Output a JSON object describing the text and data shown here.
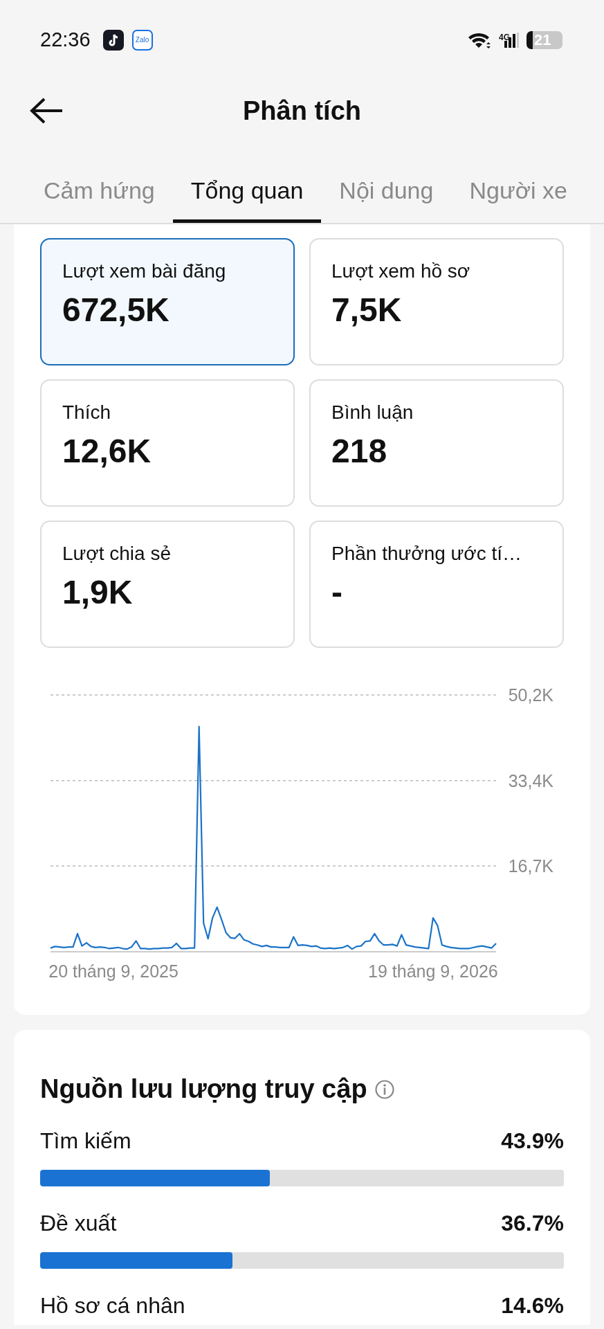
{
  "status_bar": {
    "time": "22:36",
    "apps": [
      {
        "kind": "tiktok"
      },
      {
        "kind": "zalo",
        "label": "Zalo"
      }
    ],
    "network": "4G",
    "battery": "21"
  },
  "header": {
    "title": "Phân tích"
  },
  "tabs": [
    {
      "label": "Cảm hứng",
      "selected": false
    },
    {
      "label": "Tổng quan",
      "selected": true
    },
    {
      "label": "Nội dung",
      "selected": false
    },
    {
      "label": "Người xe",
      "selected": false
    }
  ],
  "stats": [
    {
      "label": "Lượt xem bài đăng",
      "value": "672,5K",
      "selected": true
    },
    {
      "label": "Lượt xem hồ sơ",
      "value": "7,5K",
      "selected": false
    },
    {
      "label": "Thích",
      "value": "12,6K",
      "selected": false
    },
    {
      "label": "Bình luận",
      "value": "218",
      "selected": false
    },
    {
      "label": "Lượt chia sẻ",
      "value": "1,9K",
      "selected": false
    },
    {
      "label": "Phần thưởng ước tí…",
      "value": "-",
      "selected": false
    }
  ],
  "graph": {
    "chart_data": {
      "type": "line",
      "categories": [
        null,
        null,
        null,
        null,
        null,
        null,
        null,
        null,
        null,
        null,
        null,
        null,
        null,
        null,
        "20 tháng 9, 2025",
        null,
        null,
        null,
        null,
        null,
        null,
        null,
        null,
        null,
        null,
        null,
        null,
        null,
        null,
        null,
        null,
        null,
        null,
        null,
        null,
        null,
        null,
        null,
        null,
        null,
        null,
        null,
        null,
        null,
        null,
        null,
        null,
        null,
        null,
        null,
        null,
        null,
        null,
        null,
        null,
        null,
        null,
        null,
        null,
        null,
        null,
        null,
        null,
        null,
        null,
        null,
        null,
        null,
        null,
        null,
        null,
        null,
        null,
        null,
        null,
        null,
        null,
        null,
        null,
        null,
        null,
        null,
        null,
        null,
        null,
        "19 tháng 9, 2026",
        null,
        null,
        null,
        null,
        null,
        null,
        null,
        null,
        null,
        null,
        null,
        null,
        null,
        null
      ],
      "series": [
        {
          "color": "#1b73c7",
          "values": [
            0.6,
            0.9,
            0.8,
            0.7,
            0.8,
            0.8,
            3.4,
            1.0,
            1.6,
            0.9,
            0.7,
            0.8,
            0.7,
            0.5,
            0.6,
            0.7,
            0.5,
            0.4,
            0.8,
            2.0,
            0.5,
            0.5,
            0.4,
            0.5,
            0.5,
            0.6,
            0.6,
            0.7,
            1.5,
            0.5,
            0.5,
            0.6,
            0.6,
            44,
            5.5,
            2.4,
            6.5,
            8.6,
            6.2,
            3.6,
            2.6,
            2.5,
            3.4,
            2.2,
            1.9,
            1.4,
            1.2,
            0.9,
            1.1,
            0.8,
            0.8,
            0.7,
            0.7,
            0.7,
            2.8,
            1.1,
            1.2,
            1.1,
            0.9,
            1.0,
            0.6,
            0.5,
            0.6,
            0.5,
            0.6,
            0.7,
            1.1,
            0.4,
            0.9,
            1.0,
            1.9,
            2.0,
            3.4,
            2.0,
            1.2,
            1.2,
            1.3,
            1.0,
            3.2,
            1.2,
            1.0,
            0.8,
            0.7,
            0.6,
            0.5,
            6.5,
            5.0,
            1.2,
            0.9,
            0.7,
            0.6,
            0.5,
            0.5,
            0.5,
            0.7,
            0.9,
            1.0,
            0.8,
            0.6,
            1.5
          ]
        }
      ],
      "ylim": [
        0,
        50.2
      ],
      "yticks": [
        {
          "value": 50.2,
          "label": "50,2K"
        },
        {
          "value": 33.4,
          "label": "33,4K"
        },
        {
          "value": 16.7,
          "label": "16,7K"
        }
      ]
    }
  },
  "traffic": {
    "title": "Nguồn lưu lượng truy cập",
    "sources": [
      {
        "label": "Tìm kiếm",
        "percent": "43.9%",
        "level": 0.439
      },
      {
        "label": "Đề xuất",
        "percent": "36.7%",
        "level": 0.367
      },
      {
        "label": "Hồ sơ cá nhân",
        "percent": "14.6%"
      }
    ]
  }
}
